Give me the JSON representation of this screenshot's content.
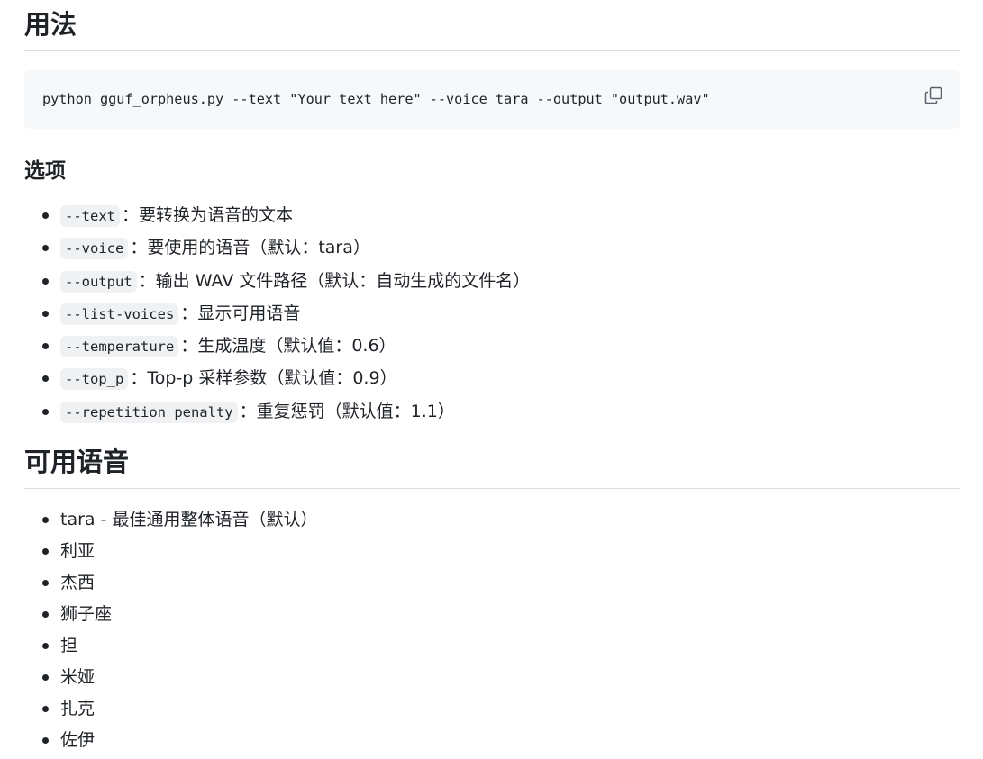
{
  "usage": {
    "heading": "用法",
    "command": "python gguf_orpheus.py --text \"Your text here\" --voice tara --output \"output.wav\"",
    "copy_icon": "copy-icon"
  },
  "options": {
    "heading": "选项",
    "items": [
      {
        "flag": "--text",
        "desc": "：要转换为语音的文本"
      },
      {
        "flag": "--voice",
        "desc": "：要使用的语音（默认：tara）"
      },
      {
        "flag": "--output",
        "desc": "：输出 WAV 文件路径（默认：自动生成的文件名）"
      },
      {
        "flag": "--list-voices",
        "desc": "：显示可用语音"
      },
      {
        "flag": "--temperature",
        "desc": "：生成温度（默认值：0.6）"
      },
      {
        "flag": "--top_p",
        "desc": "：Top-p 采样参数（默认值：0.9）"
      },
      {
        "flag": "--repetition_penalty",
        "desc": "：重复惩罚（默认值：1.1）"
      }
    ]
  },
  "voices": {
    "heading": "可用语音",
    "items": [
      "tara - 最佳通用整体语音（默认）",
      "利亚",
      "杰西",
      "狮子座",
      "担",
      "米娅",
      "扎克",
      "佐伊"
    ]
  }
}
